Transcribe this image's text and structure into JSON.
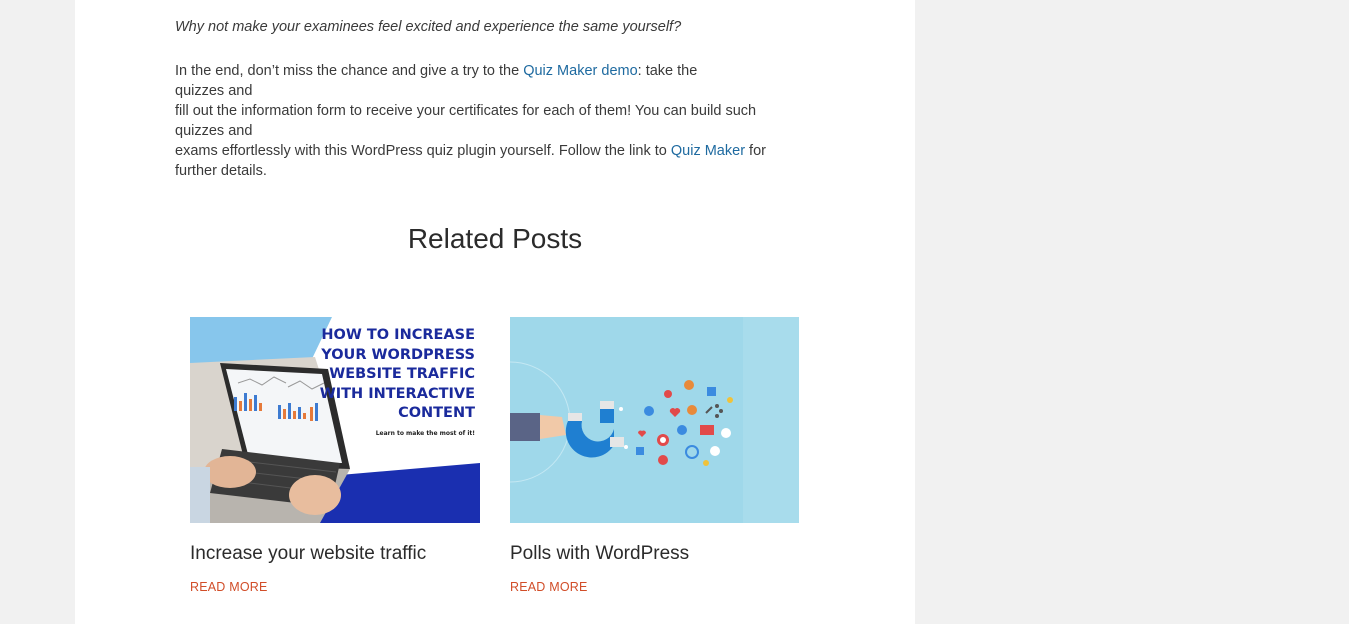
{
  "article": {
    "italic_line": "Why not make your examinees feel excited and experience the same yourself?",
    "para_part1": "In the end, don’t miss the chance and give a try to the ",
    "link_demo": "Quiz Maker demo",
    "para_part2": ": take the",
    "line2": "quizzes and",
    "line3": "fill out the information form to receive your certificates for each of them! You can build such",
    "line4": "quizzes and",
    "line5_part1": "exams effortlessly with this WordPress quiz plugin yourself. Follow the link to ",
    "link_quiz_maker": "Quiz Maker",
    "line5_part2": " for",
    "line6": "further details."
  },
  "related": {
    "title": "Related Posts",
    "posts": [
      {
        "title": "Increase your website traffic",
        "read_more": "READ MORE",
        "image_headline": [
          "HOW TO INCREASE",
          "YOUR WORDPRESS",
          "WEBSITE TRAFFIC",
          "WITH INTERACTIVE",
          "CONTENT"
        ],
        "image_subtext": "Learn to make the most of it!"
      },
      {
        "title": "Polls with WordPress",
        "read_more": "READ MORE"
      }
    ]
  },
  "colors": {
    "page_bg": "#f1f1f1",
    "link": "#1e6aa0",
    "read_more": "#d14d28",
    "thumb2_bg": "#9fd8ea",
    "thumb1_accent": "#1a2fb0"
  }
}
